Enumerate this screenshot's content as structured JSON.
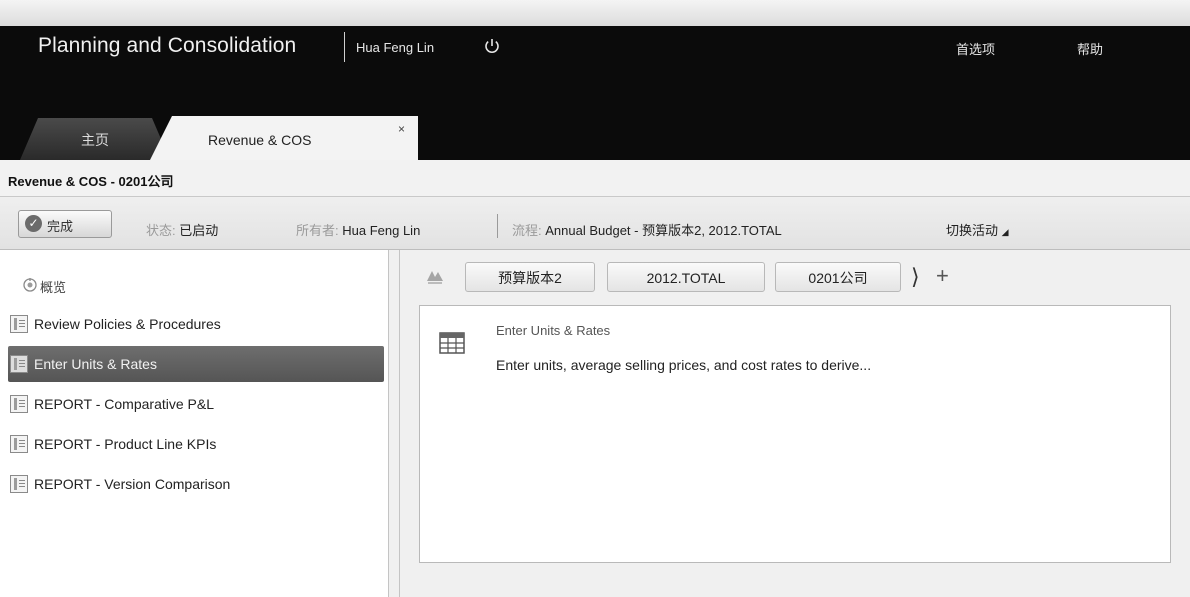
{
  "header": {
    "app_title": "Planning and Consolidation",
    "user_name": "Hua Feng Lin",
    "preferences": "首选项",
    "help": "帮助"
  },
  "tabs": [
    {
      "label": "主页"
    },
    {
      "label": "Revenue & COS",
      "close": "×"
    }
  ],
  "subheader": {
    "title": "Revenue & COS - 0201公司"
  },
  "statusbar": {
    "done_label": "完成",
    "status_label": "状态:",
    "status_value": "已启动",
    "owner_label": "所有者:",
    "owner_value": "Hua Feng Lin",
    "process_label": "流程:",
    "process_value": "Annual Budget - 预算版本2, 2012.TOTAL",
    "switch_activity": "切换活动"
  },
  "sidebar": {
    "overview": "概览",
    "items": [
      {
        "label": "Review Policies & Procedures"
      },
      {
        "label": "Enter Units & Rates"
      },
      {
        "label": "REPORT - Comparative P&L"
      },
      {
        "label": "REPORT - Product Line KPIs"
      },
      {
        "label": "REPORT - Version Comparison"
      }
    ]
  },
  "context": {
    "members": [
      "预算版本2",
      "2012.TOTAL",
      "0201公司"
    ]
  },
  "activity": {
    "title": "Enter Units & Rates",
    "description": "Enter units, average selling prices, and cost rates to derive..."
  }
}
